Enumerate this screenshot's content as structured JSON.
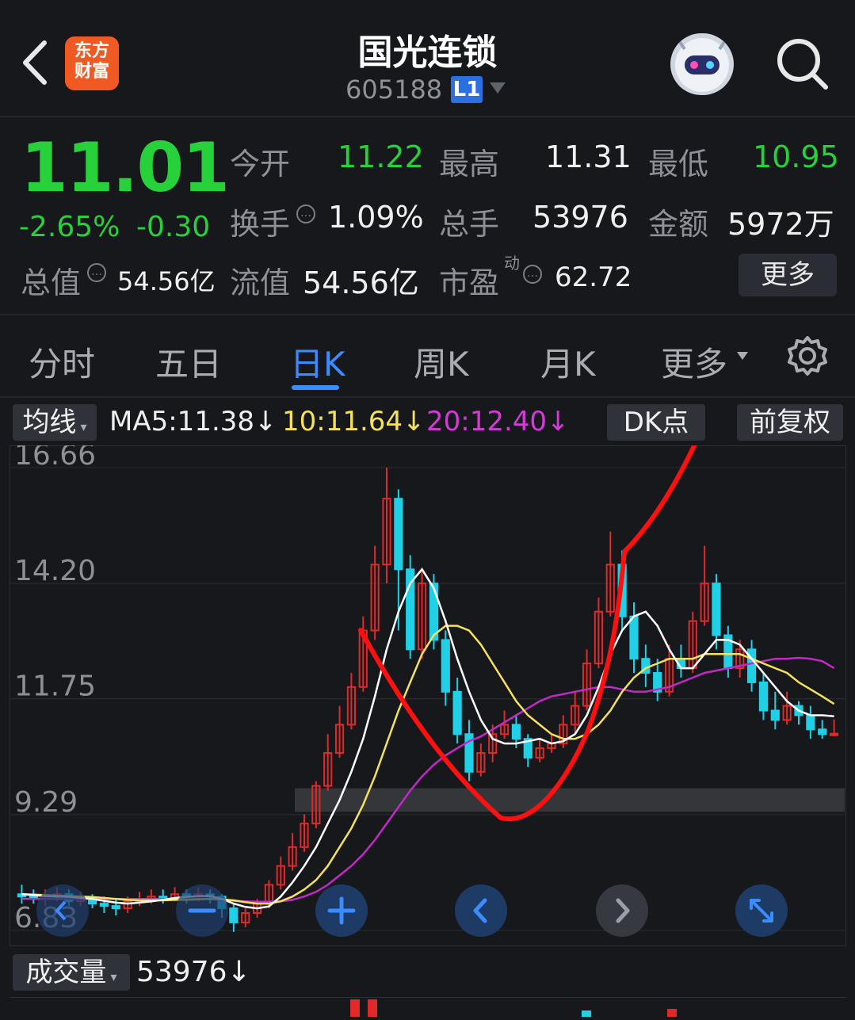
{
  "header": {
    "logo_text": "东方\n财富",
    "title": "国光连锁",
    "code": "605188",
    "level_badge": "L1"
  },
  "quote": {
    "price": "11.01",
    "change_pct": "-2.65%",
    "change_abs": "-0.30",
    "fields": [
      {
        "label": "今开",
        "value": "11.22"
      },
      {
        "label": "最高",
        "value": "11.31"
      },
      {
        "label": "最低",
        "value": "10.95"
      },
      {
        "label": "换手",
        "value": "1.09%"
      },
      {
        "label": "总手",
        "value": "53976"
      },
      {
        "label": "金额",
        "value": "5972万"
      },
      {
        "label": "总值",
        "value": "54.56亿"
      },
      {
        "label": "流值",
        "value": "54.56亿"
      },
      {
        "label": "市盈",
        "value": "62.72",
        "superscript": "动"
      }
    ],
    "more_label": "更多"
  },
  "tabs": [
    "分时",
    "五日",
    "日K",
    "周K",
    "月K",
    "更多"
  ],
  "active_tab": "日K",
  "ma_row": {
    "selector": "均线",
    "ma5": "MA5:11.38↓",
    "ma10": "10:11.64↓",
    "ma20": "20:12.40↓",
    "dk_button": "DK点",
    "adjust_button": "前复权"
  },
  "chart_data": {
    "type": "candlestick",
    "y_ticks": [
      "16.66",
      "14.20",
      "11.75",
      "9.29",
      "6.83"
    ],
    "ylim": [
      6.83,
      16.66
    ],
    "colors": {
      "up": "#e02a2a",
      "down": "#1fd0e6",
      "ma5": "#ffffff",
      "ma10": "#f5e15a",
      "ma20": "#c429c8"
    },
    "candles": [
      [
        7.6,
        7.55,
        7.8,
        7.4
      ],
      [
        7.55,
        7.5,
        7.7,
        7.4
      ],
      [
        7.5,
        7.55,
        7.7,
        7.35
      ],
      [
        7.55,
        7.6,
        7.75,
        7.45
      ],
      [
        7.6,
        7.45,
        7.7,
        7.35
      ],
      [
        7.45,
        7.5,
        7.65,
        7.35
      ],
      [
        7.5,
        7.4,
        7.6,
        7.3
      ],
      [
        7.4,
        7.35,
        7.55,
        7.2
      ],
      [
        7.35,
        7.3,
        7.5,
        7.15
      ],
      [
        7.3,
        7.45,
        7.55,
        7.2
      ],
      [
        7.45,
        7.5,
        7.65,
        7.35
      ],
      [
        7.5,
        7.55,
        7.7,
        7.4
      ],
      [
        7.55,
        7.5,
        7.7,
        7.4
      ],
      [
        7.5,
        7.6,
        7.75,
        7.45
      ],
      [
        7.6,
        7.55,
        7.7,
        7.4
      ],
      [
        7.55,
        7.6,
        7.75,
        7.45
      ],
      [
        7.6,
        7.55,
        7.7,
        7.4
      ],
      [
        7.55,
        7.3,
        7.6,
        7.1
      ],
      [
        7.3,
        7.0,
        7.4,
        6.8
      ],
      [
        7.0,
        7.2,
        7.3,
        6.9
      ],
      [
        7.2,
        7.4,
        7.5,
        7.1
      ],
      [
        7.4,
        7.8,
        7.9,
        7.3
      ],
      [
        7.8,
        8.2,
        8.4,
        7.7
      ],
      [
        8.2,
        8.6,
        8.9,
        8.1
      ],
      [
        8.6,
        9.1,
        9.3,
        8.5
      ],
      [
        9.1,
        9.9,
        10.0,
        9.0
      ],
      [
        9.9,
        10.6,
        11.0,
        9.8
      ],
      [
        10.6,
        11.2,
        11.6,
        10.5
      ],
      [
        11.2,
        12.0,
        12.3,
        11.1
      ],
      [
        12.0,
        13.2,
        13.5,
        11.9
      ],
      [
        13.2,
        14.6,
        15.0,
        13.0
      ],
      [
        14.6,
        16.0,
        16.66,
        14.2
      ],
      [
        16.0,
        14.5,
        16.2,
        13.2
      ],
      [
        14.5,
        12.8,
        14.8,
        12.6
      ],
      [
        12.8,
        14.2,
        14.5,
        12.6
      ],
      [
        14.2,
        13.0,
        14.4,
        12.8
      ],
      [
        13.0,
        11.9,
        13.2,
        11.6
      ],
      [
        11.9,
        11.0,
        12.2,
        10.8
      ],
      [
        11.0,
        10.2,
        11.3,
        10.0
      ],
      [
        10.2,
        10.6,
        10.8,
        10.1
      ],
      [
        10.6,
        11.0,
        11.2,
        10.4
      ],
      [
        11.0,
        11.2,
        11.5,
        10.9
      ],
      [
        11.2,
        10.9,
        11.4,
        10.7
      ],
      [
        10.9,
        10.5,
        11.0,
        10.3
      ],
      [
        10.5,
        10.7,
        10.9,
        10.4
      ],
      [
        10.7,
        10.8,
        11.0,
        10.6
      ],
      [
        10.8,
        11.2,
        11.4,
        10.7
      ],
      [
        11.2,
        11.6,
        11.9,
        11.0
      ],
      [
        11.6,
        12.5,
        12.8,
        11.5
      ],
      [
        12.5,
        13.6,
        13.9,
        12.4
      ],
      [
        13.6,
        14.6,
        15.3,
        13.5
      ],
      [
        14.6,
        13.5,
        14.9,
        13.2
      ],
      [
        13.5,
        12.6,
        13.8,
        12.3
      ],
      [
        12.6,
        12.3,
        12.9,
        12.0
      ],
      [
        12.3,
        11.9,
        12.6,
        11.7
      ],
      [
        11.9,
        12.6,
        12.9,
        11.8
      ],
      [
        12.6,
        12.4,
        12.9,
        12.2
      ],
      [
        12.4,
        13.4,
        13.6,
        12.3
      ],
      [
        13.4,
        14.2,
        15.0,
        13.3
      ],
      [
        14.2,
        13.1,
        14.4,
        12.8
      ],
      [
        13.1,
        12.4,
        13.3,
        12.2
      ],
      [
        12.4,
        12.8,
        13.0,
        12.2
      ],
      [
        12.8,
        12.1,
        13.0,
        11.9
      ],
      [
        12.1,
        11.5,
        12.3,
        11.3
      ],
      [
        11.5,
        11.3,
        11.9,
        11.1
      ],
      [
        11.3,
        11.6,
        11.9,
        11.2
      ],
      [
        11.6,
        11.4,
        11.7,
        11.2
      ],
      [
        11.4,
        11.1,
        11.6,
        10.9
      ],
      [
        11.1,
        11.0,
        11.3,
        10.9
      ],
      [
        11.0,
        11.01,
        11.31,
        10.95
      ]
    ],
    "ma5": [
      7.6,
      7.58,
      7.56,
      7.55,
      7.55,
      7.52,
      7.5,
      7.46,
      7.42,
      7.4,
      7.42,
      7.45,
      7.48,
      7.52,
      7.54,
      7.56,
      7.56,
      7.5,
      7.4,
      7.33,
      7.3,
      7.34,
      7.55,
      7.85,
      8.2,
      8.6,
      9.1,
      9.6,
      10.2,
      10.9,
      11.8,
      12.8,
      13.6,
      14.2,
      14.5,
      14.1,
      13.4,
      12.6,
      11.9,
      11.3,
      10.9,
      10.8,
      10.8,
      10.85,
      10.9,
      10.8,
      10.85,
      11.0,
      11.4,
      12.0,
      12.7,
      13.2,
      13.5,
      13.6,
      13.3,
      12.8,
      12.4,
      12.4,
      12.7,
      13.0,
      13.0,
      12.9,
      12.6,
      12.3,
      12.0,
      11.7,
      11.5,
      11.4,
      11.4,
      11.38
    ],
    "ma10": [
      7.6,
      7.59,
      7.58,
      7.57,
      7.56,
      7.55,
      7.54,
      7.52,
      7.5,
      7.48,
      7.47,
      7.47,
      7.47,
      7.48,
      7.48,
      7.49,
      7.5,
      7.49,
      7.47,
      7.43,
      7.4,
      7.4,
      7.45,
      7.55,
      7.7,
      7.9,
      8.2,
      8.6,
      9.0,
      9.5,
      10.1,
      10.8,
      11.5,
      12.1,
      12.7,
      13.1,
      13.3,
      13.3,
      13.2,
      12.9,
      12.5,
      12.1,
      11.7,
      11.4,
      11.2,
      11.0,
      10.9,
      10.9,
      11.0,
      11.2,
      11.5,
      11.9,
      12.2,
      12.4,
      12.5,
      12.6,
      12.6,
      12.6,
      12.7,
      12.7,
      12.7,
      12.7,
      12.6,
      12.5,
      12.4,
      12.3,
      12.1,
      11.95,
      11.8,
      11.64
    ],
    "ma20": [
      7.5,
      7.5,
      7.5,
      7.5,
      7.5,
      7.5,
      7.5,
      7.5,
      7.5,
      7.5,
      7.5,
      7.5,
      7.5,
      7.5,
      7.5,
      7.5,
      7.5,
      7.48,
      7.46,
      7.45,
      7.44,
      7.44,
      7.45,
      7.48,
      7.55,
      7.65,
      7.8,
      8.0,
      8.2,
      8.45,
      8.75,
      9.1,
      9.45,
      9.8,
      10.1,
      10.35,
      10.55,
      10.7,
      10.85,
      10.95,
      11.1,
      11.25,
      11.4,
      11.55,
      11.7,
      11.8,
      11.85,
      11.9,
      11.95,
      12.0,
      12.0,
      11.95,
      11.9,
      11.9,
      11.95,
      12.0,
      12.1,
      12.2,
      12.3,
      12.35,
      12.4,
      12.45,
      12.5,
      12.55,
      12.6,
      12.6,
      12.62,
      12.6,
      12.55,
      12.4
    ],
    "band": {
      "top": 9.85,
      "bottom": 9.35
    }
  },
  "chart_controls": [
    "zoom-in",
    "previous",
    "next",
    "fullscreen"
  ],
  "volume": {
    "selector": "成交量",
    "value": "53976↓"
  }
}
